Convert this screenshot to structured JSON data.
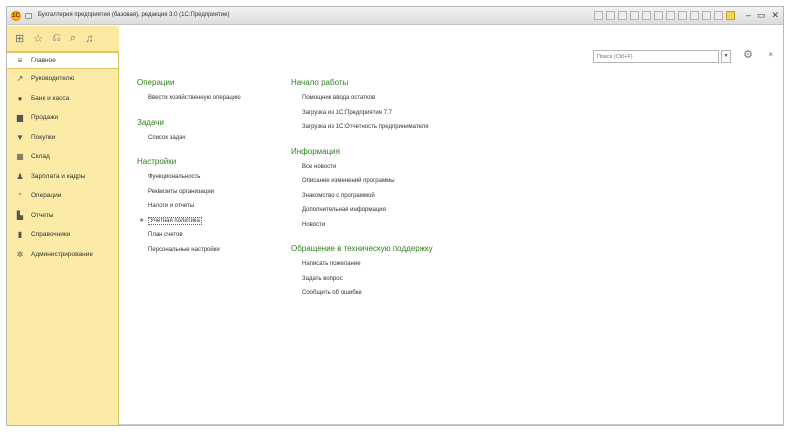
{
  "window": {
    "title": "Бухгалтерия предприятия (базовая), редакция 3.0 (1С:Предприятие)",
    "logo": "1С"
  },
  "sidebar": {
    "items": [
      {
        "label": "Главное",
        "icon": "menu-lines-icon",
        "glyph": "≡",
        "active": true
      },
      {
        "label": "Руководителю",
        "icon": "chart-trend-icon",
        "glyph": "↗"
      },
      {
        "label": "Банк и касса",
        "icon": "bank-coin-icon",
        "glyph": "●"
      },
      {
        "label": "Продажи",
        "icon": "sales-bag-icon",
        "glyph": "▆"
      },
      {
        "label": "Покупки",
        "icon": "cart-icon",
        "glyph": "▼"
      },
      {
        "label": "Склад",
        "icon": "warehouse-icon",
        "glyph": "▦"
      },
      {
        "label": "Зарплата и кадры",
        "icon": "person-icon",
        "glyph": "♟"
      },
      {
        "label": "Операции",
        "icon": "operations-icon",
        "glyph": "⁺"
      },
      {
        "label": "Отчеты",
        "icon": "reports-icon",
        "glyph": "▙"
      },
      {
        "label": "Справочники",
        "icon": "book-icon",
        "glyph": "▮"
      },
      {
        "label": "Администрирование",
        "icon": "gear-icon",
        "glyph": "✲"
      }
    ]
  },
  "search": {
    "placeholder": "Поиск (Ctrl+F)"
  },
  "content": {
    "operations": {
      "title": "Операции",
      "links": [
        "Ввести хозяйственную операцию"
      ]
    },
    "tasks": {
      "title": "Задачи",
      "links": [
        "Список задач"
      ]
    },
    "settings": {
      "title": "Настройки",
      "links": [
        "Функциональность",
        "Реквизиты организации",
        "Налоги и отчеты",
        "Учетная политика",
        "План счетов",
        "Персональные настройки"
      ]
    },
    "start": {
      "title": "Начало работы",
      "links": [
        "Помощник ввода остатков",
        "Загрузка из 1С:Предприятия 7.7",
        "Загрузка из 1С:Отчетность предпринимателя"
      ]
    },
    "info": {
      "title": "Информация",
      "links": [
        "Все новости",
        "Описание изменений программы",
        "Знакомство с программой",
        "Дополнительная информация",
        "Новости"
      ]
    },
    "support": {
      "title": "Обращение в техническую поддержку",
      "links": [
        "Написать пожелание",
        "Задать вопрос",
        "Сообщить об ошибке"
      ]
    }
  },
  "colors": {
    "accent_green": "#2f7f1f",
    "sidebar_bg": "#fbeba6"
  }
}
